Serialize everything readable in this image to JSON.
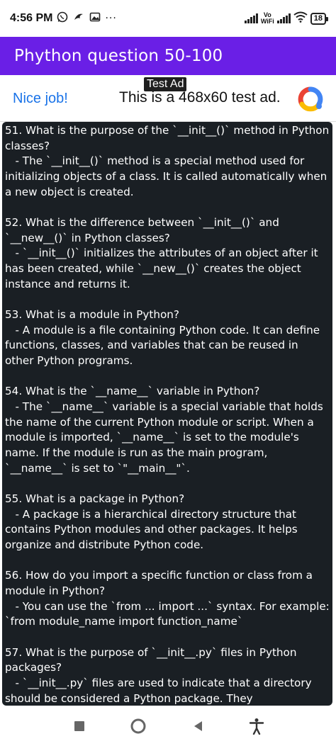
{
  "status_bar": {
    "time": "4:56 PM",
    "vowifi_top": "Vo",
    "vowifi_bottom": "WiFi",
    "battery": "18",
    "more": "···"
  },
  "app_bar": {
    "title": "Phython question 50-100"
  },
  "ad": {
    "label": "Test Ad",
    "nice_job": "Nice job!",
    "text": "This is a 468x60 test ad."
  },
  "questions": [
    {
      "question": "51. What is the purpose of the `__init__()` method in Python classes?",
      "answer": "   - The `__init__()` method is a special method used for initializing objects of a class. It is called automatically when a new object is created."
    },
    {
      "question": "52. What is the difference between `__init__()` and `__new__()` in Python classes?",
      "answer": "   - `__init__()` initializes the attributes of an object after it has been created, while `__new__()` creates the object instance and returns it."
    },
    {
      "question": "53. What is a module in Python?",
      "answer": "   - A module is a file containing Python code. It can define functions, classes, and variables that can be reused in other Python programs."
    },
    {
      "question": "54. What is the `__name__` variable in Python?",
      "answer": "   - The `__name__` variable is a special variable that holds the name of the current Python module or script. When a module is imported, `__name__` is set to the module's name. If the module is run as the main program, `__name__` is set to `\"__main__\"`."
    },
    {
      "question": "55. What is a package in Python?",
      "answer": "   - A package is a hierarchical directory structure that contains Python modules and other packages. It helps organize and distribute Python code."
    },
    {
      "question": "56. How do you import a specific function or class from a module in Python?",
      "answer": "   - You can use the `from ... import ...` syntax. For example: `from module_name import function_name`"
    },
    {
      "question": "57. What is the purpose of `__init__.py` files in Python packages?",
      "answer": "   - `__init__.py` files are used to indicate that a directory should be considered a Python package. They"
    }
  ],
  "colors": {
    "app_bar": "#6a1fe6",
    "content_bg": "#1a1f24",
    "nice_job": "#1a73e8"
  }
}
